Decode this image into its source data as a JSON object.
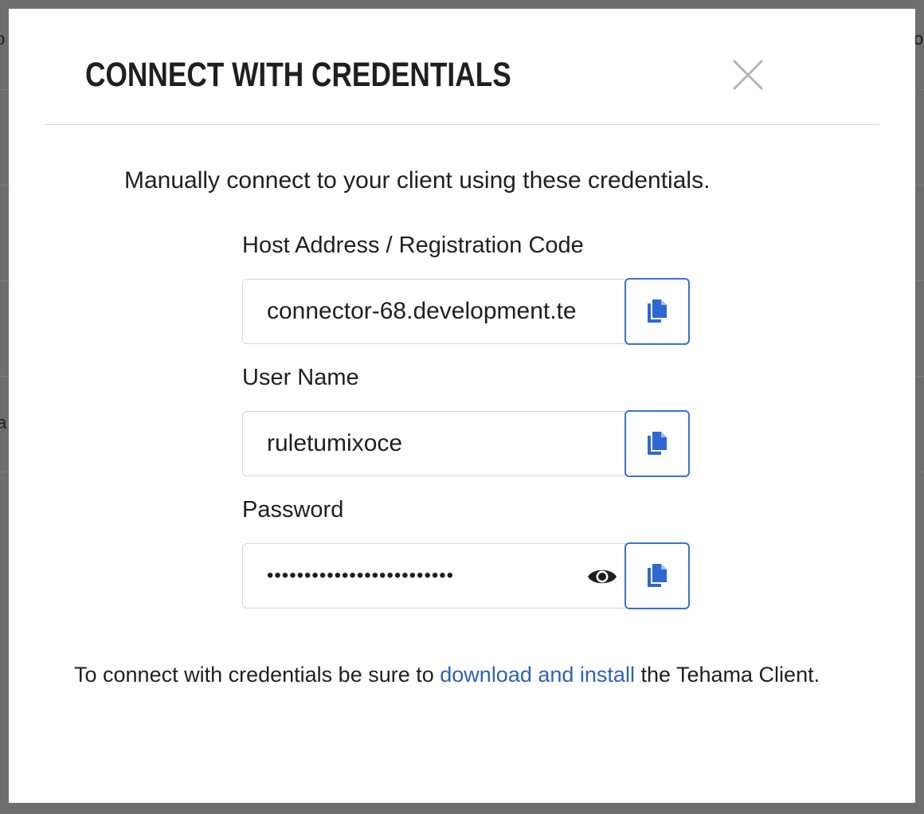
{
  "background": {
    "edge_glyphs": [
      "o",
      "o",
      "a"
    ]
  },
  "modal": {
    "title": "CONNECT WITH CREDENTIALS",
    "close_icon": "close-x-icon",
    "intro": "Manually connect to your client using these credentials.",
    "fields": [
      {
        "label": "Host Address / Registration Code",
        "value": "connector-68.development.te",
        "copy_icon": "copy-icon"
      },
      {
        "label": "User Name",
        "value": "ruletumixoce",
        "copy_icon": "copy-icon"
      },
      {
        "label": "Password",
        "value": "•••••••••••••••••••••••••",
        "reveal_icon": "eye-icon",
        "copy_icon": "copy-icon"
      }
    ],
    "footer": {
      "prefix": "To connect with credentials be sure to ",
      "link": "download and install",
      "suffix": " the Tehama Client."
    }
  },
  "colors": {
    "backdrop": "#6e6e6e",
    "accent": "#3a71d4",
    "link": "#2f62b8",
    "text": "#1f1f1f",
    "close_icon": "#b5b5b5"
  }
}
